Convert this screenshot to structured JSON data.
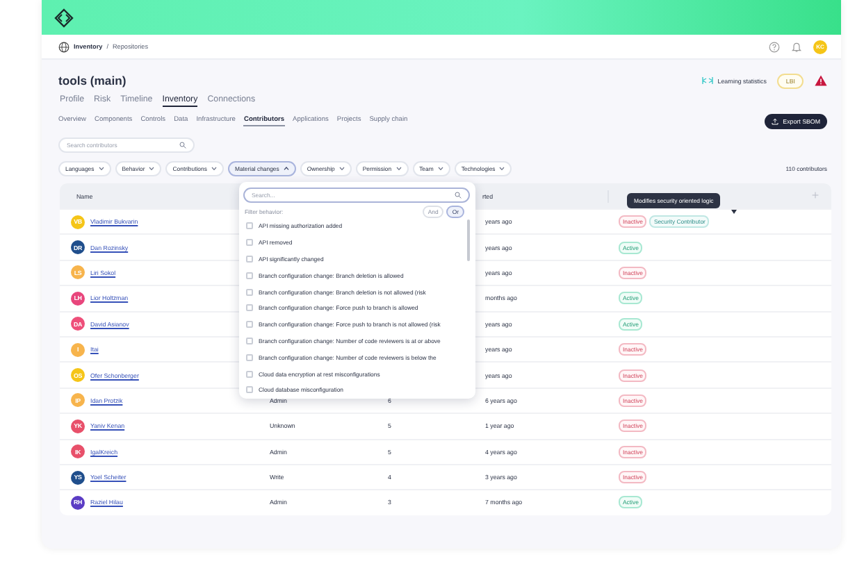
{
  "breadcrumb": [
    "Inventory",
    "Repositories"
  ],
  "breadcrumb_separator": "/",
  "user": {
    "initials": "KC"
  },
  "title": "tools (main)",
  "learning": "Learning statistics",
  "badge": "LBI",
  "tabs": [
    {
      "label": "Profile",
      "selected": false
    },
    {
      "label": "Risk",
      "selected": false
    },
    {
      "label": "Timeline",
      "selected": false
    },
    {
      "label": "Inventory",
      "selected": true
    },
    {
      "label": "Connections",
      "selected": false
    }
  ],
  "subtabs": [
    {
      "label": "Overview",
      "selected": false
    },
    {
      "label": "Components",
      "selected": false
    },
    {
      "label": "Controls",
      "selected": false
    },
    {
      "label": "Data",
      "selected": false
    },
    {
      "label": "Infrastructure",
      "selected": false
    },
    {
      "label": "Contributors",
      "selected": true
    },
    {
      "label": "Applications",
      "selected": false
    },
    {
      "label": "Projects",
      "selected": false
    },
    {
      "label": "Supply chain",
      "selected": false
    }
  ],
  "export_button": "Export SBOM",
  "search": {
    "placeholder": "Search contributors"
  },
  "filters": [
    {
      "label": "Languages",
      "expanded": false
    },
    {
      "label": "Behavior",
      "expanded": false
    },
    {
      "label": "Contributions",
      "expanded": false
    },
    {
      "label": "Material changes",
      "expanded": true
    },
    {
      "label": "Ownership",
      "expanded": false
    },
    {
      "label": "Permission",
      "expanded": false
    },
    {
      "label": "Team",
      "expanded": false
    },
    {
      "label": "Technologies",
      "expanded": false
    }
  ],
  "count": "110 contributors",
  "table": {
    "columns": [
      {
        "label": "Name",
        "kind": "name"
      },
      {
        "label": "rted",
        "kind": "last"
      }
    ],
    "rows": [
      {
        "name": "Vladimir Bukvarin",
        "initials": "VB",
        "color": "#f5c518",
        "last": "years ago",
        "tags": [
          {
            "label": "Inactive",
            "kind": "inactive"
          },
          {
            "label": "Security Contributor",
            "kind": "security"
          }
        ]
      },
      {
        "name": "Dan Rozinsky",
        "initials": "DR",
        "color": "#1f4e8c",
        "last": "years ago",
        "tags": [
          {
            "label": "Active",
            "kind": "active"
          }
        ]
      },
      {
        "name": "Liri Sokol",
        "initials": "LS",
        "color": "#f7b44c",
        "last": "years ago",
        "tags": [
          {
            "label": "Inactive",
            "kind": "inactive"
          }
        ]
      },
      {
        "name": "Lior Holtzman",
        "initials": "LH",
        "color": "#e8467c",
        "last": "months ago",
        "tags": [
          {
            "label": "Active",
            "kind": "active"
          }
        ]
      },
      {
        "name": "David Asianov",
        "initials": "DA",
        "color": "#ee4f7a",
        "last": "years ago",
        "tags": [
          {
            "label": "Active",
            "kind": "active"
          }
        ]
      },
      {
        "name": "Itai",
        "initials": "I",
        "color": "#f7b44c",
        "last": "years ago",
        "tags": [
          {
            "label": "Inactive",
            "kind": "inactive"
          }
        ]
      },
      {
        "name": "Ofer Schonberger",
        "initials": "OS",
        "color": "#f5c518",
        "last": "years ago",
        "tags": [
          {
            "label": "Inactive",
            "kind": "inactive"
          }
        ]
      },
      {
        "name": "Idan Protzik",
        "initials": "IP",
        "color": "#f7b44c",
        "role": "Admin",
        "count": "6",
        "last": "6 years ago",
        "tags": [
          {
            "label": "Inactive",
            "kind": "inactive"
          }
        ]
      },
      {
        "name": "Yaniv Kenan",
        "initials": "YK",
        "color": "#e8506a",
        "role": "Unknown",
        "count": "5",
        "last": "1 year ago",
        "tags": [
          {
            "label": "Inactive",
            "kind": "inactive"
          }
        ]
      },
      {
        "name": "IgalKreich",
        "initials": "IK",
        "color": "#e8506a",
        "role": "Admin",
        "count": "5",
        "last": "4 years ago",
        "tags": [
          {
            "label": "Inactive",
            "kind": "inactive"
          }
        ]
      },
      {
        "name": "Yoel Scheiter",
        "initials": "YS",
        "color": "#1f4e8c",
        "role": "Write",
        "count": "4",
        "last": "3 years ago",
        "tags": [
          {
            "label": "Inactive",
            "kind": "inactive"
          }
        ]
      },
      {
        "name": "Raziel Hilau",
        "initials": "RH",
        "color": "#5b3cc4",
        "role": "Admin",
        "count": "3",
        "last": "7 months ago",
        "tags": [
          {
            "label": "Active",
            "kind": "active"
          }
        ]
      }
    ]
  },
  "dropdown": {
    "placeholder": "Search...",
    "filter_label": "Filter behavior:",
    "modes": [
      {
        "label": "And",
        "selected": false
      },
      {
        "label": "Or",
        "selected": true
      }
    ],
    "options": [
      {
        "label": "API missing authorization added",
        "checked": false
      },
      {
        "label": "API removed",
        "checked": false
      },
      {
        "label": "API significantly changed",
        "checked": false
      },
      {
        "label": "Branch configuration change: Branch deletion is allowed",
        "checked": false
      },
      {
        "label": "Branch configuration change: Branch deletion is not allowed (risk",
        "checked": false
      },
      {
        "label": "Branch configuration change: Force push to branch is allowed",
        "checked": false
      },
      {
        "label": "Branch configuration change: Force push to branch is not allowed (risk",
        "checked": false
      },
      {
        "label": "Branch configuration change: Number of code reviewers is at or above",
        "checked": false
      },
      {
        "label": "Branch configuration change: Number of code reviewers is below the",
        "checked": false
      },
      {
        "label": "Cloud data encryption at rest misconfigurations",
        "checked": false
      },
      {
        "label": "Cloud database misconfiguration",
        "checked": false
      }
    ]
  },
  "tooltip": "Modifies security oriented logic"
}
